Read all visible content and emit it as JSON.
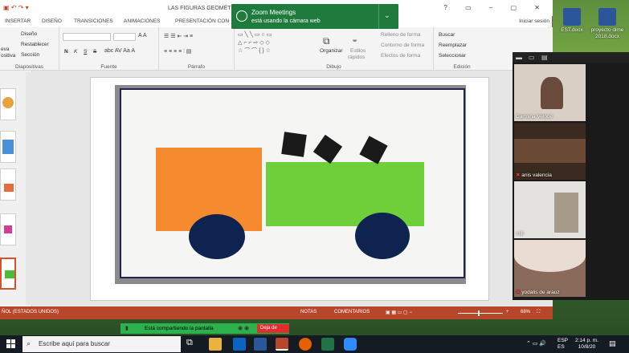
{
  "window": {
    "title": "LAS FIGURAS GEOMÉTR",
    "sign_in": "Iniciar sesión"
  },
  "tabs": [
    "INSERTAR",
    "DISEÑO",
    "TRANSICIONES",
    "ANIMACIONES",
    "PRESENTACIÓN CON"
  ],
  "ribbon": {
    "diapositivas": {
      "label": "Diapositivas",
      "nueva": "eva",
      "nueva2": "ositiva",
      "diseno": "Diseño",
      "restablecer": "Restablecer",
      "seccion": "Sección"
    },
    "fuente": {
      "label": "Fuente",
      "bold": "N",
      "italic": "K",
      "under": "S",
      "strike": "S"
    },
    "parrafo": {
      "label": "Párrafo"
    },
    "dibujo": {
      "label": "Dibujo",
      "organizar": "Organizar",
      "estilos": "Estilos",
      "estilos2": "rápidos",
      "relleno": "Relleno de forma",
      "contorno": "Contorno de forma",
      "efectos": "Efectos de forma"
    },
    "edicion": {
      "label": "Edición",
      "buscar": "Buscar",
      "reemplazar": "Reemplazar",
      "seleccionar": "Seleccionar"
    }
  },
  "statusbar": {
    "language": "ÑOL (ESTADOS UNIDOS)",
    "notas": "NOTAS",
    "comentarios": "COMENTARIOS",
    "zoom": "68%"
  },
  "zoom_toast": {
    "title": "Zoom Meetings",
    "message": "está usando la cámara web"
  },
  "gallery": {
    "participants": [
      {
        "name": "Carmina Veloce",
        "muted": false
      },
      {
        "name": "anis valencia",
        "muted": true
      },
      {
        "name": "mili",
        "muted": false
      },
      {
        "name": "yodalis de arauz",
        "muted": true
      }
    ]
  },
  "desktop_icons": [
    {
      "label": "EST.docx",
      "color": "#2b579a"
    },
    {
      "label": "proyecto dime 2018.docx",
      "color": "#2b579a"
    }
  ],
  "sharebar": {
    "text": "Está compartiendo la pantalla",
    "stop": "Deja de"
  },
  "taskbar": {
    "search_placeholder": "Escribe aquí para buscar",
    "lang": "ESP",
    "lang2": "ES",
    "time": "2:14 p. m.",
    "date": "10/8/20"
  }
}
